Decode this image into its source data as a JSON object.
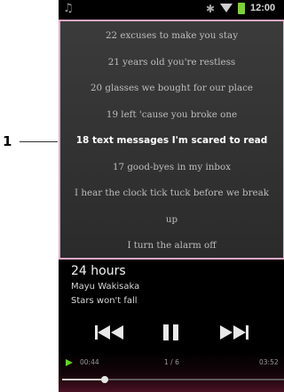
{
  "callout": {
    "number": "1"
  },
  "status_bar": {
    "time": "12:00"
  },
  "lyrics": {
    "lines": [
      "22 excuses to make you stay",
      "21 years old you're restless",
      "20 glasses we bought for our place",
      "19 left 'cause you broke one",
      "18 text messages I'm scared to read",
      "17 good-byes in my inbox",
      "I hear the clock tick tuck before we break",
      "up",
      "I turn the alarm off"
    ],
    "current_index": 4
  },
  "now_playing": {
    "title": "24 hours",
    "artist": "Mayu Wakisaka",
    "album": "Stars won't fall"
  },
  "controls": {
    "previous_icon": "previous-track-icon",
    "pause_icon": "pause-icon",
    "next_icon": "next-track-icon"
  },
  "progress": {
    "elapsed": "00:44",
    "track_position": "1 / 6",
    "duration": "03:52",
    "fraction": 0.19
  },
  "colors": {
    "highlight_border": "#e9a8c8",
    "play_indicator": "#62d12e",
    "battery": "#7cd13b"
  }
}
